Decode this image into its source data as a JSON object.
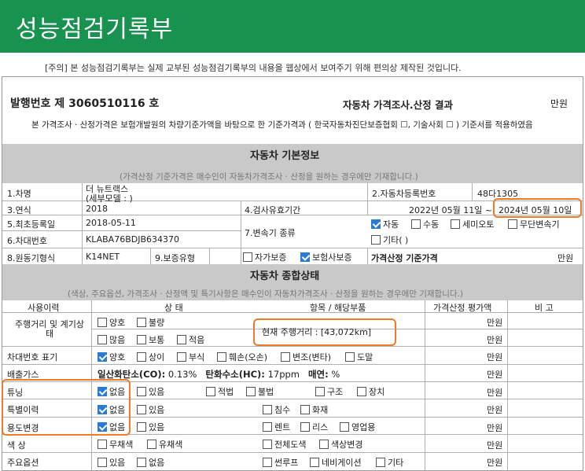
{
  "header": {
    "title": "성능점검기록부"
  },
  "notice": "[주의] 본 성능점검기록부는 실제 교부된 성능점검기록부의 내용을 웹상에서 보여주기 위해 편의상 제작된 것입니다.",
  "doc": {
    "issue_no": "발행번호 제 3060510116 호",
    "valuation_title": "자동차 가격조사.산정 결과",
    "unit": "만원",
    "basis_text": "본 가격조사 · 산정가격은 보험개발원의 차량기준가액을 바탕으로 한 기준가격과 ( 한국자동차진단보증협회 ☐, 기술사회 ☐ ) 기준서를 적용하였음"
  },
  "basic": {
    "title": "자동차 기본정보",
    "subtitle": "(가격산정 기준가격은 매수인이 자동차가격조사 · 산정을 원하는 경우에만 기재합니다.)",
    "car_name_label": "1.차명",
    "car_name_value_1": "더 뉴트랙스",
    "car_name_value_2": "(세부모델 : )",
    "reg_no_label": "2.자동차등록번호",
    "reg_no_value": "48다1305",
    "year_label": "3.연식",
    "year_value": "2018",
    "inspect_label": "4.검사유효기간",
    "inspect_from": "2022년 05월 11일 ~",
    "inspect_to": "2024년 05월 10일",
    "first_reg_label": "5.최초등록일",
    "first_reg_value": "2018-05-11",
    "trans_label": "7.변속기 종류",
    "trans_opts": [
      "자동",
      "수동",
      "세미오토",
      "무단변속기",
      "기타( )"
    ],
    "vin_label": "6.차대번호",
    "vin_value": "KLABA76BDJB634370",
    "engine_label": "8.원동기형식",
    "engine_value": "K14NET",
    "warranty_label": "9.보증유형",
    "warranty_opts": [
      "자가보증",
      "보험사보증"
    ],
    "base_price_label": "가격산정 기준가격",
    "base_price_unit": "만원"
  },
  "overall": {
    "title": "자동차 종합상태",
    "subtitle": "(색상, 주요옵션, 가격조사 · 산정액 및 특기사항은 매수인이 자동차가격조사 · 산정을 원하는 경우에만 기재합니다.)",
    "cols": [
      "사용이력",
      "상 태",
      "항목 / 해당부품",
      "가격산정 평가액",
      "비 고"
    ],
    "mileage_label": "주행거리 및 계기상태",
    "mileage_opts_1": [
      "양호",
      "불량"
    ],
    "mileage_opts_2": [
      "많음",
      "보통",
      "적음"
    ],
    "mileage_now": "현재 주행거리 : [43,072km]",
    "vin_mark_label": "차대번호 표기",
    "vin_mark_opts": [
      "양호",
      "상이",
      "부식",
      "훼손(오손)",
      "변조(변타)",
      "도말"
    ],
    "emission_label": "배출가스",
    "emission_co": "일산화탄소(CO):",
    "emission_co_val": "0.13%",
    "emission_hc": "탄화수소(HC):",
    "emission_hc_val": "17ppm",
    "emission_smoke": "매연:",
    "emission_smoke_val": "%",
    "tuning_label": "튜닝",
    "tuning_opts": [
      "없음",
      "있음",
      "적법",
      "불법",
      "구조",
      "장치"
    ],
    "special_label": "특별이력",
    "special_opts": [
      "없음",
      "있음",
      "침수",
      "화재"
    ],
    "usage_label": "용도변경",
    "usage_opts": [
      "없음",
      "있음",
      "렌트",
      "리스",
      "영업용"
    ],
    "color_label": "색 상",
    "color_opts": [
      "무채색",
      "유채색",
      "전체도색",
      "색상변경"
    ],
    "options_label": "주요옵션",
    "options_opts": [
      "있음",
      "없음",
      "썬루프",
      "네비게이션",
      "기타"
    ],
    "unit": "만원"
  }
}
